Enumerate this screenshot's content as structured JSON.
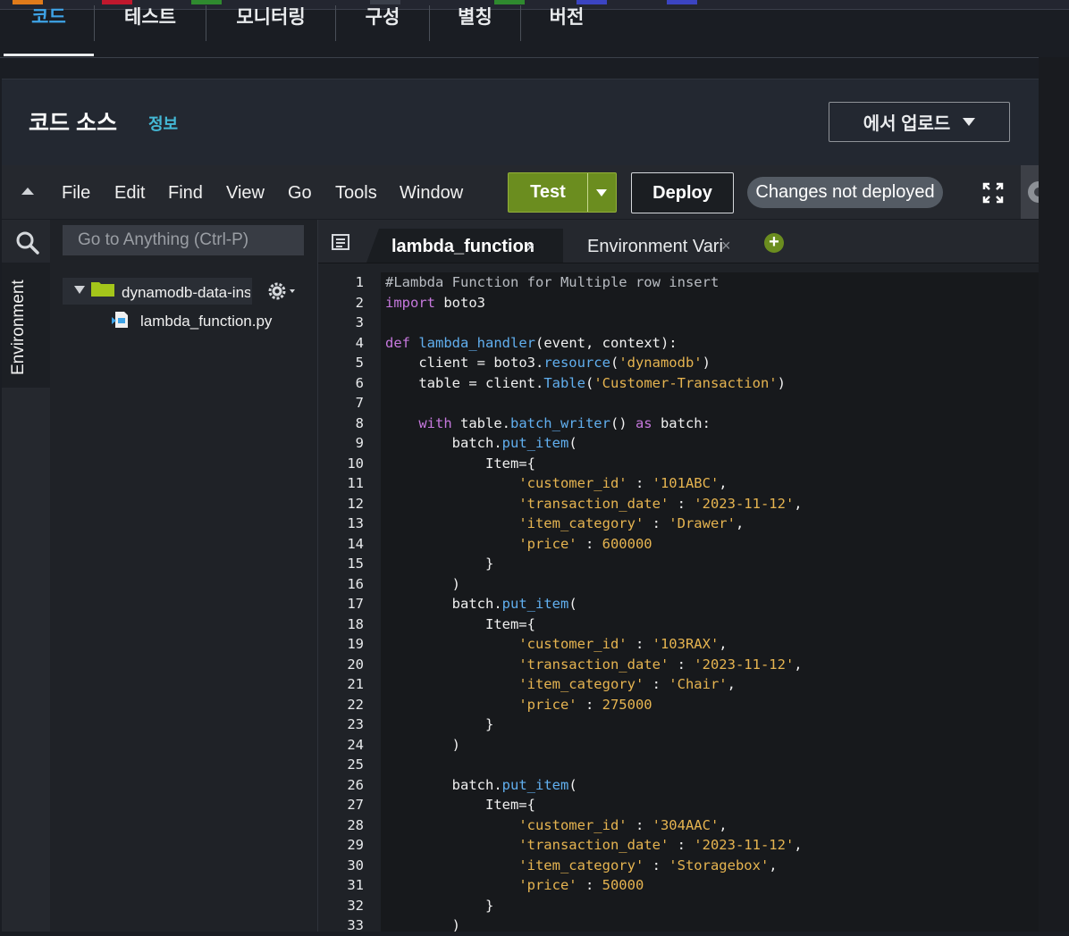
{
  "tabs": [
    {
      "label": "코드",
      "active": true
    },
    {
      "label": "테스트",
      "active": false
    },
    {
      "label": "모니터링",
      "active": false
    },
    {
      "label": "구성",
      "active": false
    },
    {
      "label": "별칭",
      "active": false
    },
    {
      "label": "버전",
      "active": false
    }
  ],
  "panel": {
    "title": "코드 소스",
    "info": "정보",
    "upload_label": "에서 업로드"
  },
  "toolbar": {
    "menu": [
      "File",
      "Edit",
      "Find",
      "View",
      "Go",
      "Tools",
      "Window"
    ],
    "test_label": "Test",
    "deploy_label": "Deploy",
    "status": "Changes not deployed"
  },
  "sidebar": {
    "environment_label": "Environment",
    "goto_placeholder": "Go to Anything (Ctrl-P)",
    "folder": "dynamodb-data-insert",
    "file": "lambda_function.py"
  },
  "editor_tabs": [
    {
      "label": "lambda_function",
      "active": true
    },
    {
      "label": "Environment Vari",
      "active": false
    }
  ],
  "colors": {
    "accent": "#3ea3e6",
    "test_button": "#6b8d1f",
    "folder": "#a4c61a",
    "status_pill": "#545b64"
  },
  "code": [
    [
      [
        "comment",
        "#Lambda Function for Multiple row insert"
      ]
    ],
    [
      [
        "kw",
        "import"
      ],
      [
        "op",
        " boto3"
      ]
    ],
    [],
    [
      [
        "kw",
        "def"
      ],
      [
        "op",
        " "
      ],
      [
        "fn",
        "lambda_handler"
      ],
      [
        "op",
        "(event, context):"
      ]
    ],
    [
      [
        "op",
        "    client "
      ],
      [
        "op",
        "= boto3."
      ],
      [
        "attr",
        "resource"
      ],
      [
        "op",
        "("
      ],
      [
        "str",
        "'dynamodb'"
      ],
      [
        "op",
        ")"
      ]
    ],
    [
      [
        "op",
        "    table = client."
      ],
      [
        "attr",
        "Table"
      ],
      [
        "op",
        "("
      ],
      [
        "str",
        "'Customer-Transaction'"
      ],
      [
        "op",
        ")"
      ]
    ],
    [],
    [
      [
        "op",
        "    "
      ],
      [
        "kw",
        "with"
      ],
      [
        "op",
        " table."
      ],
      [
        "attr",
        "batch_writer"
      ],
      [
        "op",
        "() "
      ],
      [
        "kw",
        "as"
      ],
      [
        "op",
        " batch:"
      ]
    ],
    [
      [
        "op",
        "        batch."
      ],
      [
        "attr",
        "put_item"
      ],
      [
        "op",
        "("
      ]
    ],
    [
      [
        "op",
        "            Item={"
      ]
    ],
    [
      [
        "op",
        "                "
      ],
      [
        "str",
        "'customer_id'"
      ],
      [
        "op",
        " : "
      ],
      [
        "str",
        "'101ABC'"
      ],
      [
        "op",
        ","
      ]
    ],
    [
      [
        "op",
        "                "
      ],
      [
        "str",
        "'transaction_date'"
      ],
      [
        "op",
        " : "
      ],
      [
        "str",
        "'2023-11-12'"
      ],
      [
        "op",
        ","
      ]
    ],
    [
      [
        "op",
        "                "
      ],
      [
        "str",
        "'item_category'"
      ],
      [
        "op",
        " : "
      ],
      [
        "str",
        "'Drawer'"
      ],
      [
        "op",
        ","
      ]
    ],
    [
      [
        "op",
        "                "
      ],
      [
        "str",
        "'price'"
      ],
      [
        "op",
        " : "
      ],
      [
        "num",
        "600000"
      ]
    ],
    [
      [
        "op",
        "            }"
      ]
    ],
    [
      [
        "op",
        "        )"
      ]
    ],
    [
      [
        "op",
        "        batch."
      ],
      [
        "attr",
        "put_item"
      ],
      [
        "op",
        "("
      ]
    ],
    [
      [
        "op",
        "            Item={"
      ]
    ],
    [
      [
        "op",
        "                "
      ],
      [
        "str",
        "'customer_id'"
      ],
      [
        "op",
        " : "
      ],
      [
        "str",
        "'103RAX'"
      ],
      [
        "op",
        ","
      ]
    ],
    [
      [
        "op",
        "                "
      ],
      [
        "str",
        "'transaction_date'"
      ],
      [
        "op",
        " : "
      ],
      [
        "str",
        "'2023-11-12'"
      ],
      [
        "op",
        ","
      ]
    ],
    [
      [
        "op",
        "                "
      ],
      [
        "str",
        "'item_category'"
      ],
      [
        "op",
        " : "
      ],
      [
        "str",
        "'Chair'"
      ],
      [
        "op",
        ","
      ]
    ],
    [
      [
        "op",
        "                "
      ],
      [
        "str",
        "'price'"
      ],
      [
        "op",
        " : "
      ],
      [
        "num",
        "275000"
      ]
    ],
    [
      [
        "op",
        "            }"
      ]
    ],
    [
      [
        "op",
        "        )"
      ]
    ],
    [],
    [
      [
        "op",
        "        batch."
      ],
      [
        "attr",
        "put_item"
      ],
      [
        "op",
        "("
      ]
    ],
    [
      [
        "op",
        "            Item={"
      ]
    ],
    [
      [
        "op",
        "                "
      ],
      [
        "str",
        "'customer_id'"
      ],
      [
        "op",
        " : "
      ],
      [
        "str",
        "'304AAC'"
      ],
      [
        "op",
        ","
      ]
    ],
    [
      [
        "op",
        "                "
      ],
      [
        "str",
        "'transaction_date'"
      ],
      [
        "op",
        " : "
      ],
      [
        "str",
        "'2023-11-12'"
      ],
      [
        "op",
        ","
      ]
    ],
    [
      [
        "op",
        "                "
      ],
      [
        "str",
        "'item_category'"
      ],
      [
        "op",
        " : "
      ],
      [
        "str",
        "'Storagebox'"
      ],
      [
        "op",
        ","
      ]
    ],
    [
      [
        "op",
        "                "
      ],
      [
        "str",
        "'price'"
      ],
      [
        "op",
        " : "
      ],
      [
        "num",
        "50000"
      ]
    ],
    [
      [
        "op",
        "            }"
      ]
    ],
    [
      [
        "op",
        "        )"
      ]
    ]
  ]
}
